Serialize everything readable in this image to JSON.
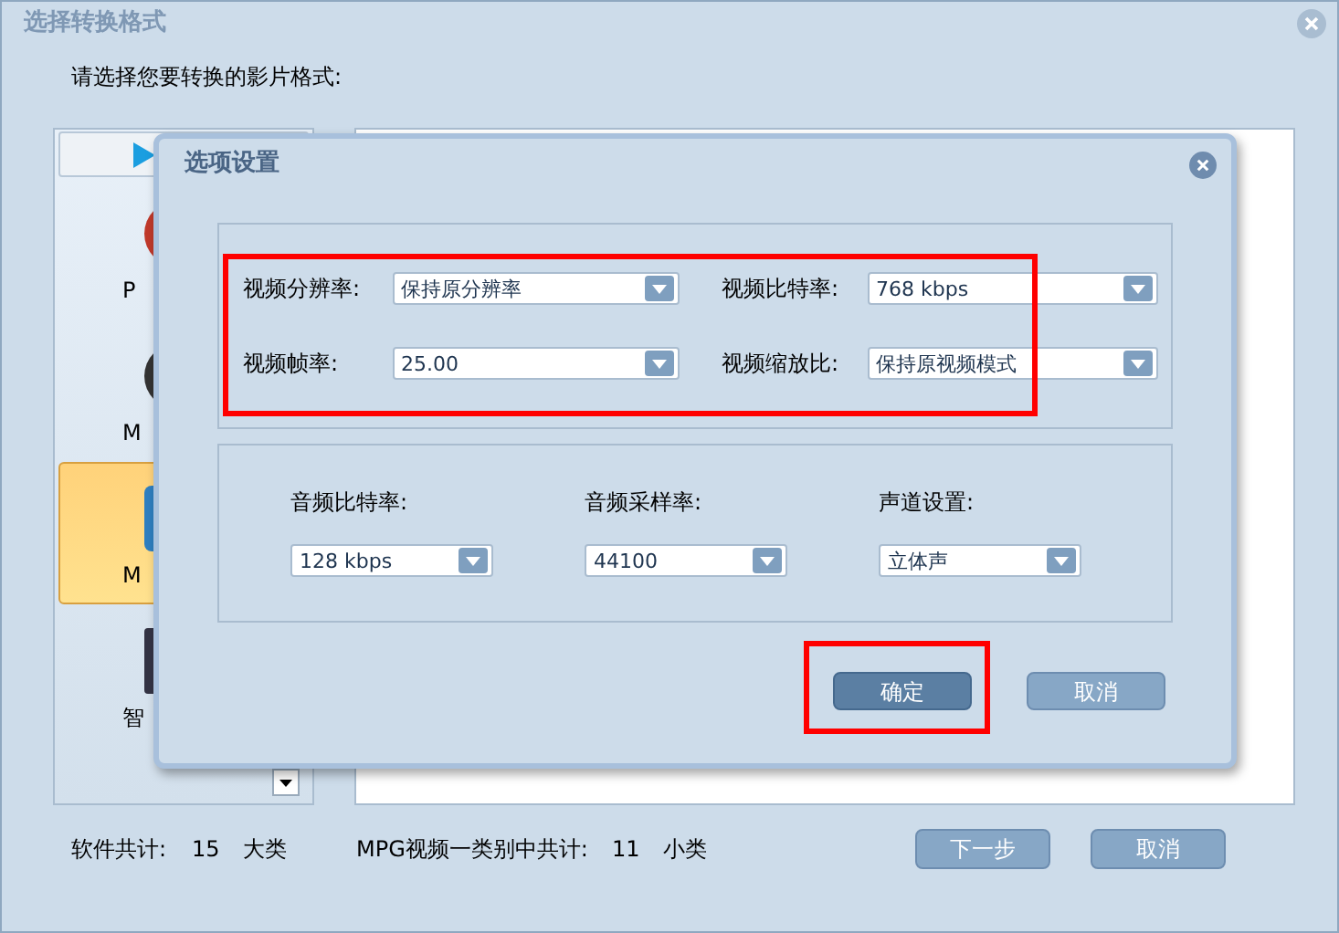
{
  "window": {
    "title": "选择转换格式"
  },
  "instruction": "请选择您要转换的影片格式:",
  "categories": [
    {
      "label": "P",
      "selected": false
    },
    {
      "label": "M",
      "selected": false
    },
    {
      "label": "M",
      "selected": true
    },
    {
      "label": "智",
      "selected": false
    }
  ],
  "footer": {
    "total_label": "软件共计:",
    "total": "15",
    "total_unit": "大类",
    "sub_label": "MPG视频一类别中共计:",
    "sub_total": "11",
    "sub_unit": "小类"
  },
  "buttons": [
    {
      "label": "下一步"
    },
    {
      "label": "取消"
    }
  ],
  "dialog": {
    "title": "选项设置",
    "video_fields": [
      {
        "label": "视频分辨率:",
        "value": "保持原分辨率"
      },
      {
        "label": "视频比特率:",
        "value": "768 kbps"
      },
      {
        "label": "视频帧率:",
        "value": "25.00"
      },
      {
        "label": "视频缩放比:",
        "value": "保持原视频模式"
      }
    ],
    "audio_fields": [
      {
        "label": "音频比特率:",
        "value": "128 kbps"
      },
      {
        "label": "音频采样率:",
        "value": "44100"
      },
      {
        "label": "声道设置:",
        "value": "立体声"
      }
    ],
    "buttons": [
      {
        "label": "确定",
        "default": true
      },
      {
        "label": "取消",
        "default": false
      }
    ]
  }
}
